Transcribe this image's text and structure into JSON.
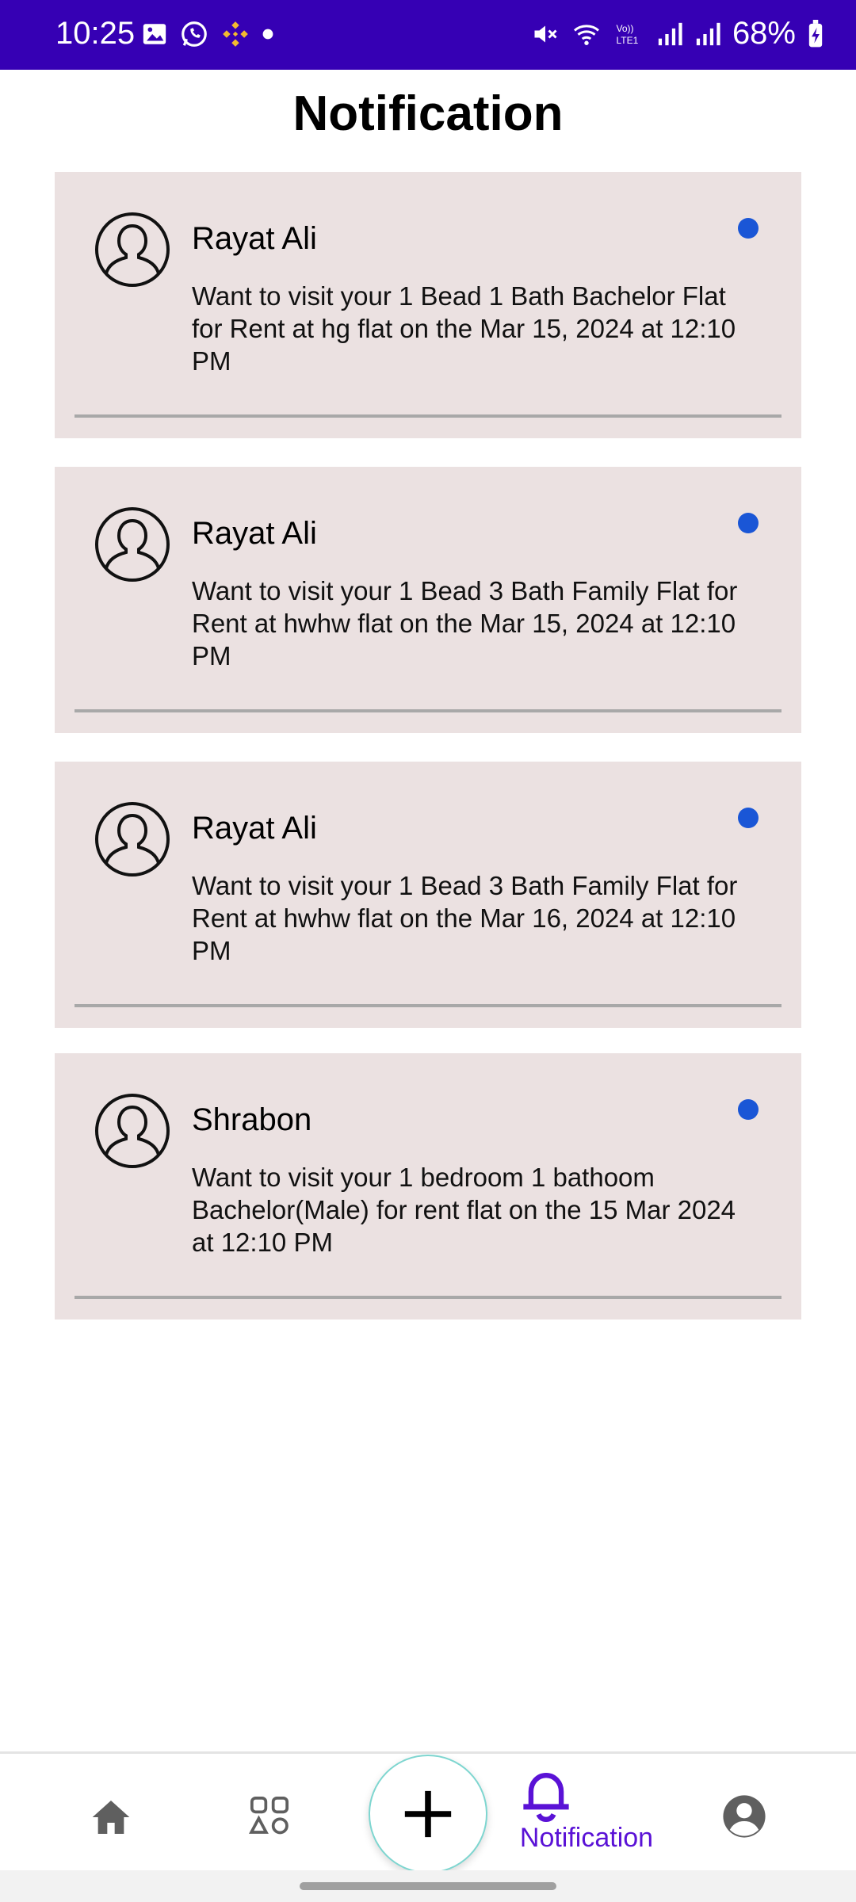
{
  "status_bar": {
    "time": "10:25",
    "battery": "68%",
    "icons": [
      "gallery-icon",
      "whatsapp-icon",
      "binance-icon",
      "dot-icon",
      "mute-icon",
      "wifi-icon",
      "volte-icon",
      "signal-icon",
      "signal-icon",
      "battery-charging-icon"
    ],
    "bg_color": "#3600B4"
  },
  "header": {
    "title": "Notification"
  },
  "notifications": [
    {
      "name": "Rayat Ali",
      "message": "Want to visit your 1 Bead 1 Bath Bachelor Flat for Rent at hg flat on the Mar 15, 2024 at 12:10 PM",
      "unread": true
    },
    {
      "name": "Rayat Ali",
      "message": "Want to visit your 1 Bead 3 Bath Family Flat for Rent at hwhw flat on the Mar 15, 2024 at 12:10 PM",
      "unread": true
    },
    {
      "name": "Rayat Ali",
      "message": "Want to visit your 1 Bead 3 Bath Family Flat for Rent at hwhw flat on the Mar 16, 2024 at 12:10 PM",
      "unread": true
    },
    {
      "name": "Shrabon",
      "message": "Want to visit your 1 bedroom 1 bathoom Bachelor(Male) for rent flat on the 15 Mar 2024 at 12:10 PM",
      "unread": true
    }
  ],
  "bottom_nav": {
    "items": [
      {
        "icon": "home-icon"
      },
      {
        "icon": "categories-icon"
      },
      {
        "icon": "plus-icon"
      },
      {
        "icon": "bell-icon",
        "label": "Notification",
        "active": true
      },
      {
        "icon": "profile-icon"
      }
    ],
    "active_color": "#5A12D6"
  }
}
